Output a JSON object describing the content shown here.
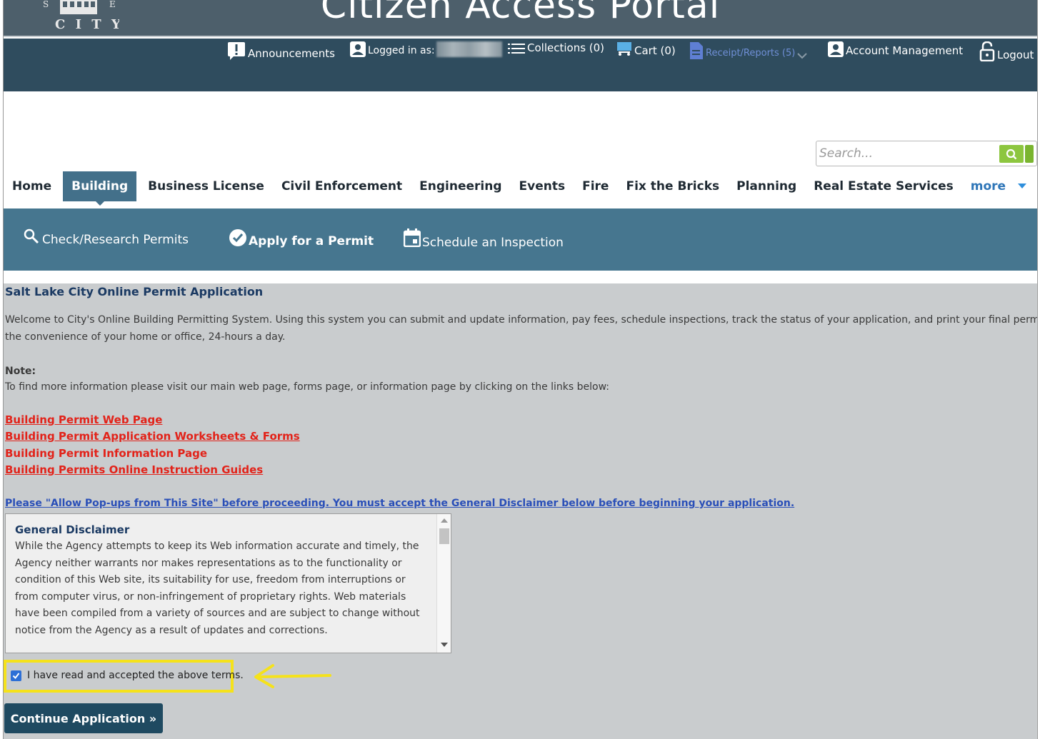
{
  "header": {
    "portal_title": "Citizen Access Portal",
    "logo_text": "CITY"
  },
  "utility": {
    "announcements": "Announcements",
    "logged_in_as": "Logged in as:",
    "collections": "Collections (0)",
    "cart": "Cart (0)",
    "receipts": "Receipt/Reports (5)",
    "account_management": "Account Management",
    "logout": "Logout"
  },
  "search": {
    "placeholder": "Search..."
  },
  "nav": {
    "items": [
      "Home",
      "Building",
      "Business License",
      "Civil Enforcement",
      "Engineering",
      "Events",
      "Fire",
      "Fix the Bricks",
      "Planning",
      "Real Estate Services",
      "more"
    ],
    "active": "Building"
  },
  "subnav": {
    "check": "Check/Research Permits",
    "apply": "Apply for a Permit",
    "schedule": "Schedule an Inspection"
  },
  "content": {
    "title": "Salt Lake City Online Permit Application",
    "welcome_1": "Welcome to City's Online Building Permitting System. Using this system you can submit and update information, pay fees, schedule inspections, track the status of your application, and print your final permit all from",
    "welcome_2": "the convenience of your home or office, 24-hours a day.",
    "note_title": "Note:",
    "note_text": "To find more information please visit our main web page, forms page, or information page by clicking on the links below:",
    "links": [
      "Building Permit Web Page",
      "Building Permit Application Worksheets & Forms",
      "Building Permit Information Page",
      "Building Permits Online Instruction Guides"
    ],
    "popup_notice": "Please \"Allow Pop-ups from This Site\" before proceeding. You must accept the General Disclaimer below before beginning your application."
  },
  "disclaimer": {
    "title": "General Disclaimer",
    "body": "While the Agency attempts to keep its Web information accurate and timely, the Agency neither warrants nor makes representations as to the functionality or condition of this Web site, its suitability for use, freedom from interruptions or from computer virus, or non-infringement of proprietary rights. Web materials have been compiled from a variety of sources and are subject to change without notice from the Agency as a result of updates and corrections."
  },
  "accept": {
    "label": "I have read and accepted the above terms.",
    "checked": true
  },
  "continue_button": "Continue Application »",
  "colors": {
    "banner": "#4d5f6b",
    "utility_bar": "#2f4c5e",
    "subnav": "#46768f",
    "active_tab": "#43708a",
    "content_bg": "#c9ccce",
    "link_red": "#e2231a",
    "highlight_yellow": "#f5e21b",
    "button": "#1f4a61"
  },
  "icons": [
    "announcement-icon",
    "user-icon",
    "list-icon",
    "cart-icon",
    "document-icon",
    "account-icon",
    "lock-icon",
    "search-icon",
    "check-circle-icon",
    "calendar-icon",
    "chevron-down-icon",
    "arrow-left-icon"
  ]
}
